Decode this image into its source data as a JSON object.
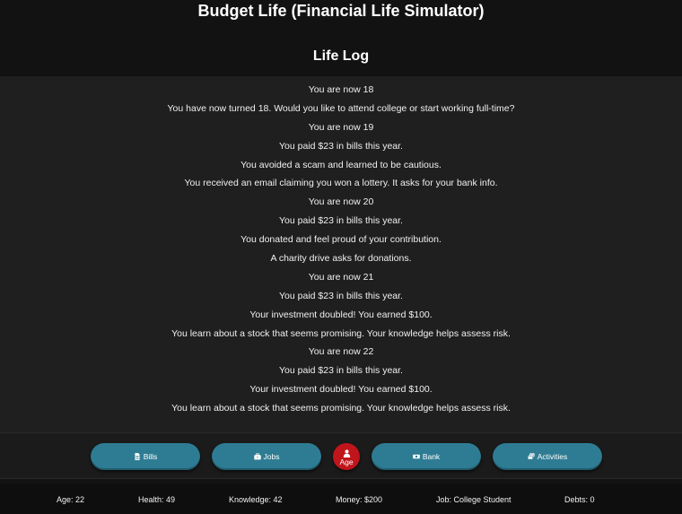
{
  "app": {
    "title": "Budget Life (Financial Life Simulator)"
  },
  "log": {
    "title": "Life Log",
    "entries": [
      "You are now 18",
      "You have now turned 18. Would you like to attend college or start working full-time?",
      "You are now 19",
      "You paid $23 in bills this year.",
      "You avoided a scam and learned to be cautious.",
      "You received an email claiming you won a lottery. It asks for your bank info.",
      "You are now 20",
      "You paid $23 in bills this year.",
      "You donated and feel proud of your contribution.",
      "A charity drive asks for donations.",
      "You are now 21",
      "You paid $23 in bills this year.",
      "Your investment doubled! You earned $100.",
      "You learn about a stock that seems promising. Your knowledge helps assess risk.",
      "You are now 22",
      "You paid $23 in bills this year.",
      "Your investment doubled! You earned $100.",
      "You learn about a stock that seems promising. Your knowledge helps assess risk."
    ]
  },
  "actions": {
    "bills": {
      "label": "Bills",
      "icon": "document-icon"
    },
    "jobs": {
      "label": "Jobs",
      "icon": "briefcase-icon"
    },
    "age": {
      "label": "Age",
      "icon": "person-icon"
    },
    "bank": {
      "label": "Bank",
      "icon": "money-bill-icon"
    },
    "activities": {
      "label": "Activities",
      "icon": "layers-icon"
    }
  },
  "status": {
    "age": "Age: 22",
    "health": "Health: 49",
    "knowledge": "Knowledge: 42",
    "money": "Money: $200",
    "job": "Job: College Student",
    "debts": "Debts: 0"
  },
  "colors": {
    "background": "#121212",
    "log_panel": "#1f1f1f",
    "button": "#2e7c93",
    "age_button": "#c0151b"
  }
}
